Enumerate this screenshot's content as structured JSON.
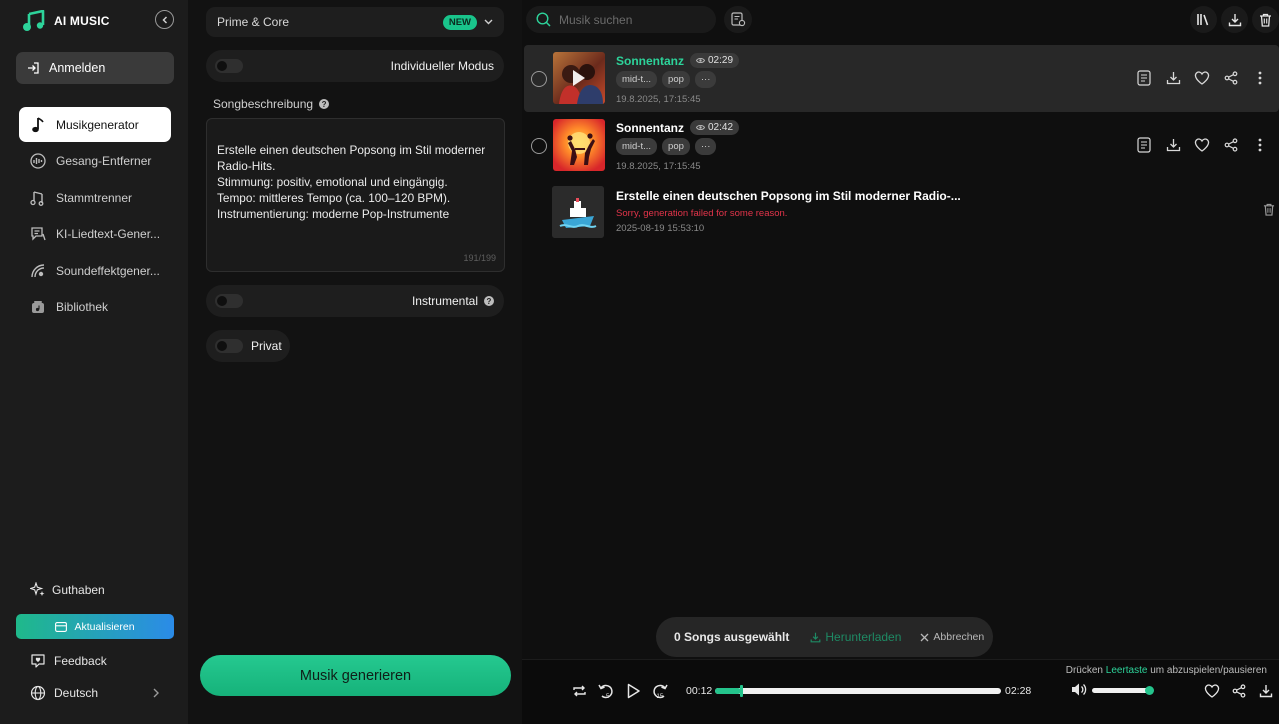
{
  "app": {
    "name": "AI MUSIC"
  },
  "sidebar": {
    "login_label": "Anmelden",
    "items": [
      {
        "label": "Musikgenerator",
        "icon": "music-note-icon",
        "active": true
      },
      {
        "label": "Gesang-Entferner",
        "icon": "vocal-remover-icon",
        "active": false
      },
      {
        "label": "Stammtrenner",
        "icon": "stem-splitter-icon",
        "active": false
      },
      {
        "label": "KI-Liedtext-Gener...",
        "icon": "lyrics-icon",
        "active": false
      },
      {
        "label": "Soundeffektgener...",
        "icon": "sound-effect-icon",
        "active": false
      },
      {
        "label": "Bibliothek",
        "icon": "library-icon",
        "active": false
      }
    ],
    "credits_label": "Guthaben",
    "upgrade_label": "Aktualisieren",
    "feedback_label": "Feedback",
    "language_label": "Deutsch"
  },
  "generator": {
    "model": "Prime & Core",
    "model_badge": "NEW",
    "custom_mode_label": "Individueller Modus",
    "description_label": "Songbeschreibung",
    "description_text": "Erstelle einen deutschen Popsong im Stil moderner Radio-Hits.\nStimmung: positiv, emotional und eingängig.\nTempo: mittleres Tempo (ca. 100–120 BPM).\nInstrumentierung: moderne Pop-Instrumente",
    "char_count": "191/199",
    "instrumental_label": "Instrumental",
    "private_label": "Privat",
    "generate_label": "Musik generieren"
  },
  "library": {
    "search_placeholder": "Musik suchen",
    "songs": [
      {
        "title": "Sonnentanz",
        "duration": "02:29",
        "tags": [
          "mid-t...",
          "pop",
          "···"
        ],
        "date": "19.8.2025, 17:15:45",
        "selected": true
      },
      {
        "title": "Sonnentanz",
        "duration": "02:42",
        "tags": [
          "mid-t...",
          "pop",
          "···"
        ],
        "date": "19.8.2025, 17:15:45",
        "selected": false
      }
    ],
    "failed": {
      "title": "Erstelle einen deutschen Popsong im Stil moderner Radio-...",
      "message": "Sorry, generation failed for some reason.",
      "date": "2025-08-19 15:53:10"
    }
  },
  "selection": {
    "count_label": "0 Songs ausgewählt",
    "download_label": "Herunterladen",
    "cancel_label": "Abbrechen"
  },
  "player": {
    "hint_prefix": "Drücken",
    "hint_key": "Leertaste",
    "hint_suffix": "um abzuspielen/pausieren",
    "current_time": "00:12",
    "total_time": "02:28",
    "progress_fraction": 0.09,
    "volume_fraction": 0.95
  },
  "colors": {
    "accent": "#24c48c",
    "error": "#e2344a",
    "background": "#111111"
  }
}
